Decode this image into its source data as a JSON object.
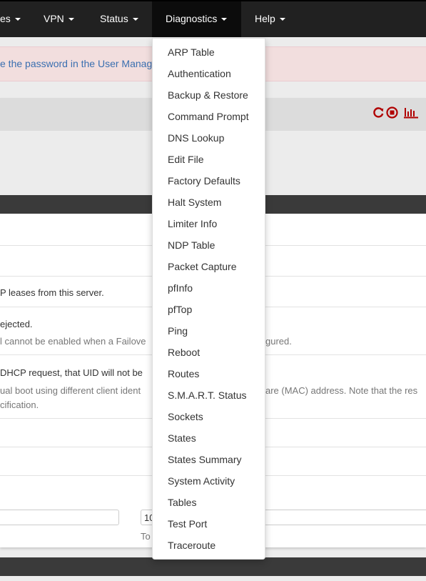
{
  "navbar": {
    "items": [
      {
        "label": "es",
        "dropdown": true
      },
      {
        "label": "VPN",
        "dropdown": true
      },
      {
        "label": "Status",
        "dropdown": true
      },
      {
        "label": "Diagnostics",
        "dropdown": true,
        "active": true
      },
      {
        "label": "Help",
        "dropdown": true
      }
    ]
  },
  "alert": {
    "text": "e the password in the User Manage"
  },
  "panel_header": {
    "icons": [
      "restart-icon",
      "stop-icon",
      "graph-icon"
    ],
    "icon_color": "#b00000"
  },
  "form": {
    "lines": [
      {
        "text": "P leases from this server."
      },
      {
        "text": "ejected."
      },
      {
        "text": "l cannot be enabled when a Failove"
      },
      {
        "text": "gured."
      },
      {
        "text": "DHCP request, that UID will not be"
      },
      {
        "text": "ual boot using different client ident"
      },
      {
        "text": "are (MAC) address. Note that the res"
      },
      {
        "text": "cification."
      }
    ],
    "range_to_value": "10",
    "range_to_label": "To"
  },
  "diagnostics_menu": {
    "items": [
      "ARP Table",
      "Authentication",
      "Backup & Restore",
      "Command Prompt",
      "DNS Lookup",
      "Edit File",
      "Factory Defaults",
      "Halt System",
      "Limiter Info",
      "NDP Table",
      "Packet Capture",
      "pfInfo",
      "pfTop",
      "Ping",
      "Reboot",
      "Routes",
      "S.M.A.R.T. Status",
      "Sockets",
      "States",
      "States Summary",
      "System Activity",
      "Tables",
      "Test Port",
      "Traceroute"
    ]
  },
  "colors": {
    "navbar": "#212121",
    "alert_bg": "#f2dede",
    "link": "#3a6fb0",
    "section_bar": "#3a3a3a"
  }
}
